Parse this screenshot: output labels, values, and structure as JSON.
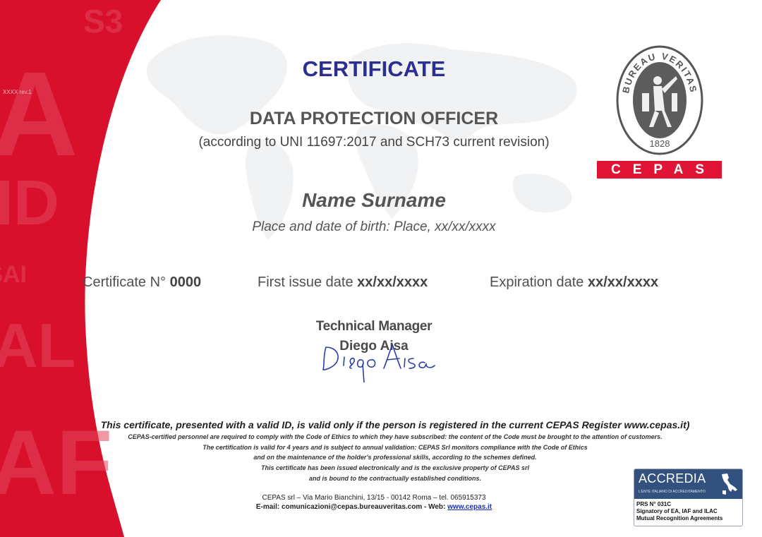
{
  "title": "CERTIFICATE",
  "subtitle": "DATA PROTECTION OFFICER",
  "according": "(according to UNI 11697:2017 and SCH73 current revision)",
  "holder": {
    "name": "Name Surname",
    "birth": "Place and date of birth: Place, xx/xx/xxxx"
  },
  "certificate": {
    "number_label": "Certificate N°",
    "number": "0000",
    "first_issue_label": "First issue date",
    "first_issue": "xx/xx/xxxx",
    "expiration_label": "Expiration date",
    "expiration": "xx/xx/xxxx"
  },
  "manager": {
    "title": "Technical Manager",
    "name": "Diego Aisa",
    "signature_text": "Diego Aisa"
  },
  "footer": {
    "validity": "This certificate, presented with a valid ID, is valid only if the person is registered in the current CEPAS Register www.cepas.it)",
    "lines": [
      "CEPAS-certified personnel are required to comply with the Code of Ethics to which they have subscribed: the content of the Code must be brought to the attention of customers.",
      "The certification is valid for 4 years and is subject to annual validation: CEPAS Srl monitors compliance with the Code of Ethics",
      "and on the maintenance of the holder's professional skills, according to the schemes defined.",
      "This certificate has been issued electronically and is the exclusive property of CEPAS srl",
      "and is bound to the contractually established conditions."
    ],
    "address": "CEPAS srl – Via Mario Bianchini, 13/15 - 00142 Roma – tel. 065915373",
    "email_prefix": "E-mail: comunicazioni@cepas.bureauveritas.com  - Web: ",
    "web": "www.cepas.it"
  },
  "logos": {
    "bv_text": "BUREAU VERITAS",
    "bv_year": "1828",
    "cepas": "CEPAS",
    "accredia": "ACCREDIA",
    "accredia_sub": "L'ENTE ITALIANO DI ACCREDITAMENTO",
    "prs": "PRS N° 031C",
    "signatory_1": "Signatory of EA, IAF and ILAC",
    "signatory_2": "Mutual Recognition Agreements"
  },
  "ribbon_ref": "XXXX rev.1",
  "colors": {
    "title_blue": "#2b2f8f",
    "ribbon_red": "#d8102c",
    "cepas_red": "#e01535",
    "accredia_blue": "#33517f",
    "link_blue": "#1c2fb0"
  }
}
